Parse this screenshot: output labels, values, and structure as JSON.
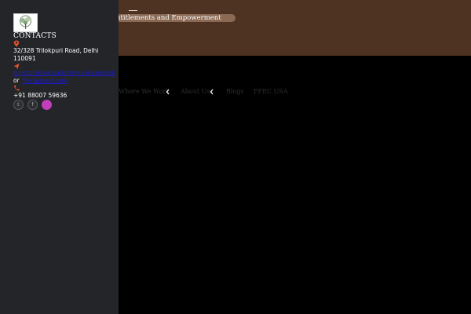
{
  "hero": {
    "tagline": "ntitlements and Empowerment"
  },
  "nav": {
    "items": [
      {
        "label": "Where We Work",
        "has_dropdown": true
      },
      {
        "label": "About Us",
        "has_dropdown": true
      },
      {
        "label": "Blogs",
        "has_dropdown": false
      },
      {
        "label": "FFEC USA",
        "has_dropdown": false
      }
    ]
  },
  "sidebar": {
    "title": "CONTACTS",
    "address": "32/328 Trilokpuri  Road, Delhi 110091",
    "email_primary": "director@foundationforequityandentitlements.org",
    "or_label": "or",
    "email_secondary": "ffec@gmail.com",
    "phone": "+91 88007 59636",
    "socials": [
      {
        "icon": "twitter-icon",
        "glyph": "𝕥"
      },
      {
        "icon": "facebook-icon",
        "glyph": "f"
      },
      {
        "icon": "instagram-icon",
        "glyph": ""
      }
    ]
  },
  "colors": {
    "hero_bg": "#4e3322",
    "sidebar_bg": "#232528",
    "accent_icon": "#e0522e",
    "link": "#1b1bd6",
    "instagram": "#c13fb8"
  }
}
